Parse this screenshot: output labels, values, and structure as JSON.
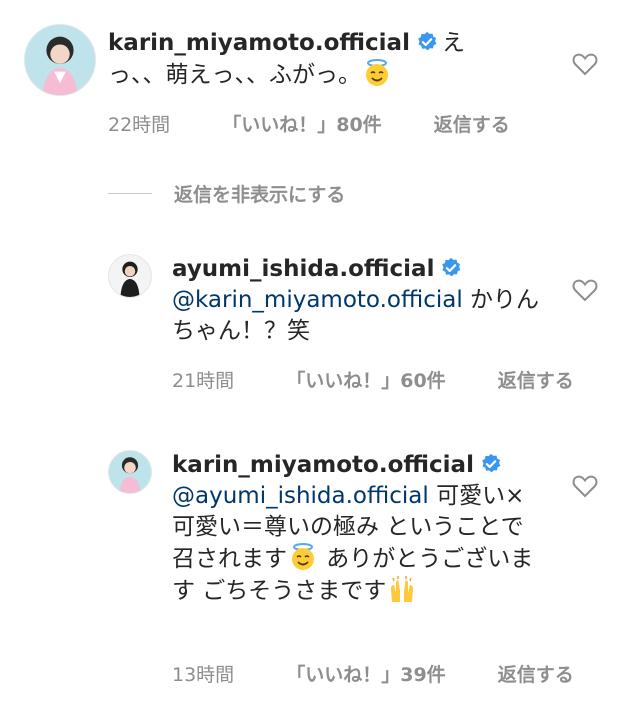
{
  "comments": [
    {
      "username": "karin_miyamoto.official",
      "text_after_user": "えっ、、萌えっ、、ふがっ。",
      "emoji": "innocent-face-emoji",
      "time": "22時間",
      "likes": "「いいね！」80件",
      "reply": "返信する"
    },
    {
      "username": "ayumi_ishida.official",
      "mention": "@karin_miyamoto.official",
      "text": " かりんちゃん！？笑",
      "time": "21時間",
      "likes": "「いいね！」60件",
      "reply": "返信する"
    },
    {
      "username": "karin_miyamoto.official",
      "mention": "@ayumi_ishida.official",
      "text_part1": " 可愛い×可愛い＝尊いの極み ということで召されます",
      "text_part2": " ありがとうございます ごちそうさまです",
      "emoji1": "innocent-face-emoji",
      "emoji2": "raising-hands-emoji",
      "time": "13時間",
      "likes": "「いいね！」39件",
      "reply": "返信する"
    }
  ],
  "hide_replies": "返信を非表示にする",
  "colors": {
    "verified": "#3897f0",
    "mention": "#00376b",
    "meta": "#8e8e8e"
  }
}
